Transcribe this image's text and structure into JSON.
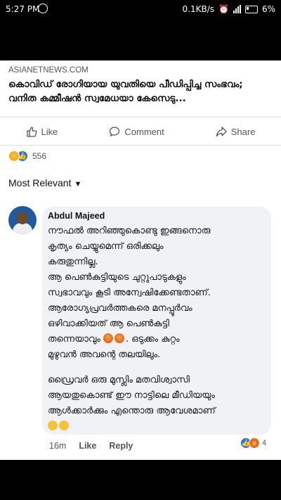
{
  "status_bar": {
    "time": "5:27 PM",
    "network_speed": "0.1KB/s",
    "battery": "6%"
  },
  "post": {
    "source": "ASIANETNEWS.COM",
    "headline": "കൊവിഡ് രോഗിയായ യുവതിയെ പീഡിപ്പിച്ച സംഭവം; വനിത കമ്മീഷൻ സ്വമേധയാ കേസെടു...",
    "actions": {
      "like": "Like",
      "comment": "Comment",
      "share": "Share"
    },
    "reactions_count": "556"
  },
  "comments": {
    "sort_label": "Most Relevant",
    "items": [
      {
        "author": "Abdul Majeed",
        "lines": [
          "നൗഫൽ അറിഞ്ഞുകൊണ്ടു ഇങ്ങനൊരു",
          "കൃത്യം ചെയ്യുമെന്ന് ഒരിക്കലും",
          "കരുതുന്നില്ല.",
          "ആ പെൺകുട്ടിയുടെ ചുറ്റുപാടുകളും",
          "സ്വഭാവവും കൂടി അന്വേഷിക്കേണ്ടതാണ്.",
          "ആരോഗ്യപ്രവർത്തകരെ മനപ്പൂർവം",
          "ഒഴിവാക്കിയത് ആ പെൺകുട്ടി",
          "തന്നെയാവും",
          ". ഒടുക്കം കുറ്റം",
          "മുഴുവൻ അവന്റെ തലയിലും.",
          "ഡ്രൈവർ ഒരു മുസ്ലിം മതവിശ്വാസി",
          "ആയതുകൊണ്ട് ഈ നാട്ടിലെ മീഡിയയും",
          "ആൾക്കാർക്കും എന്തൊരു ആവേശമാണ്"
        ],
        "time": "16m",
        "like_label": "Like",
        "reply_label": "Reply",
        "reactions_count": "4"
      }
    ]
  }
}
